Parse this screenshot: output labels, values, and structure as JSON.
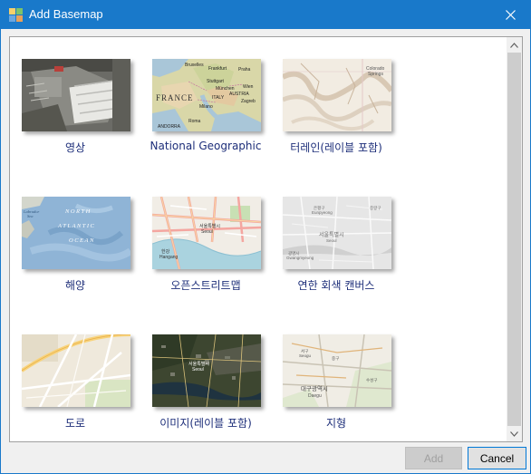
{
  "window": {
    "title": "Add Basemap",
    "close_glyph": "✕",
    "accent_color": "#1979ca"
  },
  "basemaps": [
    {
      "label": "영상",
      "thumb": "imagery"
    },
    {
      "label": "National Geographic",
      "thumb": "natgeo"
    },
    {
      "label": "터레인(레이블 포함)",
      "thumb": "terrain"
    },
    {
      "label": "해양",
      "thumb": "ocean"
    },
    {
      "label": "오픈스트리트맵",
      "thumb": "osm"
    },
    {
      "label": "연한 회색 캔버스",
      "thumb": "lightgray"
    },
    {
      "label": "도로",
      "thumb": "streets"
    },
    {
      "label": "이미지(레이블 포함)",
      "thumb": "hybrid"
    },
    {
      "label": "지형",
      "thumb": "topo"
    }
  ],
  "thumb_text": {
    "natgeo": [
      "Bruxelles",
      "Frankfurt",
      "Praha",
      "Stuttgart",
      "München",
      "FRANCE",
      "Wien",
      "AUSTRIA",
      "ITALY",
      "Zagreb",
      "Milano",
      "Roma",
      "ANDORRA"
    ],
    "terrain": [
      "Colorado",
      "Springs"
    ],
    "ocean": [
      "NORTH",
      "ATLANTIC",
      "OCEAN",
      "Labrador",
      "Sea"
    ],
    "osm": [
      "서울특별시",
      "Seoul",
      "한강",
      "Hangang"
    ],
    "lightgray": [
      "은평구",
      "Eunpyeong",
      "서울특별시",
      "Seoul",
      "중랑구",
      "광명시",
      "Gwangmyeong"
    ],
    "hybrid": [
      "서울특별시",
      "Seoul"
    ],
    "topo": [
      "대구광역시",
      "Daegu",
      "수성구",
      "중구",
      "서구",
      "Seogu"
    ]
  },
  "buttons": {
    "add": "Add",
    "cancel": "Cancel"
  },
  "scrollbar": {
    "up_glyph": "▲",
    "down_glyph": "▼"
  }
}
